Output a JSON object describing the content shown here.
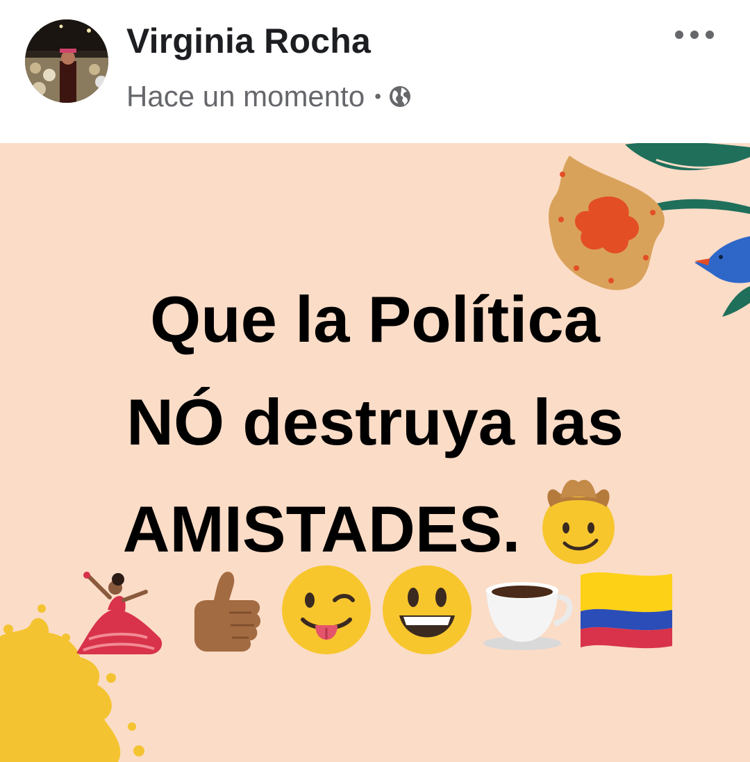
{
  "post": {
    "author_name": "Virginia Rocha",
    "timestamp": "Hace un momento",
    "separator": "•",
    "privacy_icon": "globe-icon",
    "menu_icon": "more-options-icon",
    "background_color": "#fbdcc7",
    "text_lines": [
      "Que la Política",
      "NÓ destruya las",
      "AMISTADES."
    ],
    "inline_emoji": "cowboy-face-emoji",
    "emojis": [
      "flamenco-dancer-emoji",
      "thumbs-up-emoji",
      "winking-tongue-face-emoji",
      "grinning-face-emoji",
      "coffee-cup-emoji",
      "colombia-flag-emoji"
    ]
  }
}
